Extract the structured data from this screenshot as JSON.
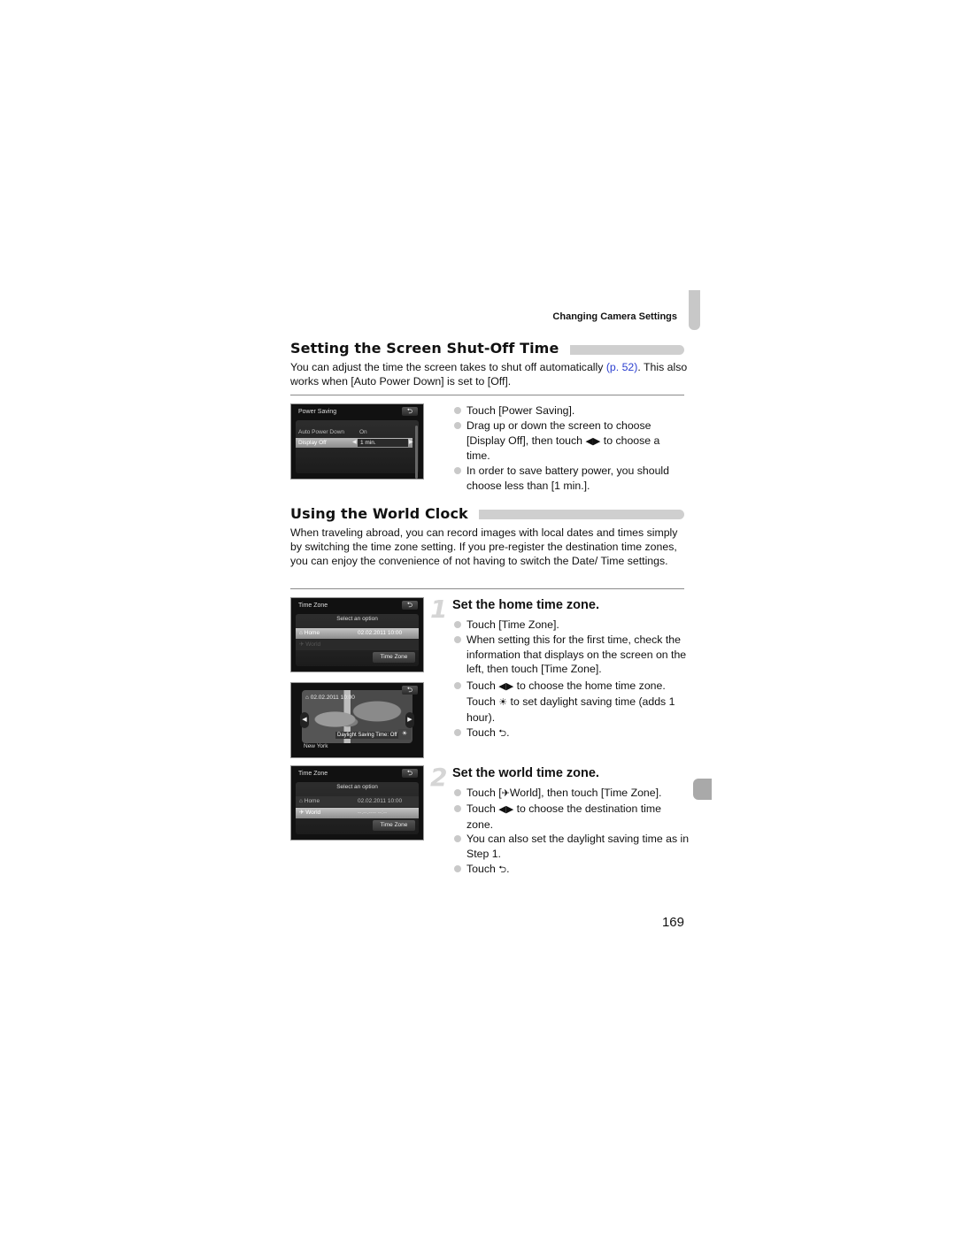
{
  "running_header": "Changing Camera Settings",
  "page_number": "169",
  "section1": {
    "title": "Setting the Screen Shut-Off Time",
    "intro_before_link": "You can adjust the time the screen takes to shut off automatically ",
    "intro_link": "(p. 52)",
    "intro_after_link": ". This also works when [Auto Power Down] is set to [Off].",
    "screen": {
      "title": "Power Saving",
      "back_icon": "return-arrow-icon",
      "rows": [
        {
          "label": "Auto Power Down",
          "value": "On",
          "selected": false
        },
        {
          "label": "Display Off",
          "value": "1 min.",
          "selected": true
        }
      ]
    },
    "bullets": [
      "Touch [Power Saving].",
      "Drag up or down the screen to choose [Display Off], then touch",
      "to choose a time.",
      "In order to save battery power, you should choose less than [1 min.]."
    ]
  },
  "section2": {
    "title": "Using the World Clock",
    "intro": "When traveling abroad, you can record images with local dates and times simply by switching the time zone setting. If you pre-register the destination time zones, you can enjoy the convenience of not having to switch the Date/ Time settings.",
    "screens": {
      "tz_home": {
        "title": "Time Zone",
        "subtitle": "Select an option",
        "rows": [
          {
            "label": "Home",
            "icon": "home-icon",
            "value": "02.02.2011 10:00",
            "selected": true
          },
          {
            "label": "World",
            "icon": "airplane-icon",
            "value": "--.--.---- --:--",
            "selected": false
          }
        ],
        "button": "Time Zone"
      },
      "map": {
        "date": "02.02.2011 10:00",
        "dst_label": "Daylight Saving Time: Off",
        "dst_icon": "OFF",
        "city": "New York"
      },
      "tz_world": {
        "title": "Time Zone",
        "subtitle": "Select an option",
        "rows": [
          {
            "label": "Home",
            "icon": "home-icon",
            "value": "02.02.2011 10:00",
            "selected": false
          },
          {
            "label": "World",
            "icon": "airplane-icon",
            "value": "--.--.---- --:--",
            "selected": true
          }
        ],
        "button": "Time Zone"
      }
    },
    "steps": [
      {
        "number": "1",
        "title": "Set the home time zone.",
        "bullets": {
          "b1": "Touch [Time Zone].",
          "b2": "When setting this for the first time, check the information that displays on the screen on the left, then touch [Time Zone].",
          "b3_a": "Touch",
          "b3_b": "to choose the home time zone.",
          "b3_c": "Touch",
          "b3_d": "to set daylight saving time (adds 1 hour).",
          "b4_a": "Touch",
          "b4_b": "."
        }
      },
      {
        "number": "2",
        "title": "Set the world time zone.",
        "bullets": {
          "b1_a": "Touch [",
          "b1_b": "World], then touch [Time Zone].",
          "b2_a": "Touch",
          "b2_b": "to choose the destination time zone.",
          "b3": "You can also set the daylight saving time as in Step 1.",
          "b4_a": "Touch",
          "b4_b": "."
        }
      }
    ]
  },
  "glyphs": {
    "left_right": "◀▶",
    "back": "⮌",
    "dst": "☀",
    "plane": "✈",
    "home": "⌂"
  },
  "colors": {
    "link": "#2b3fcf",
    "section_bar": "#cfcfcf",
    "bullet_dot": "#c9c9c9",
    "step_number": "#d5d5d5"
  }
}
